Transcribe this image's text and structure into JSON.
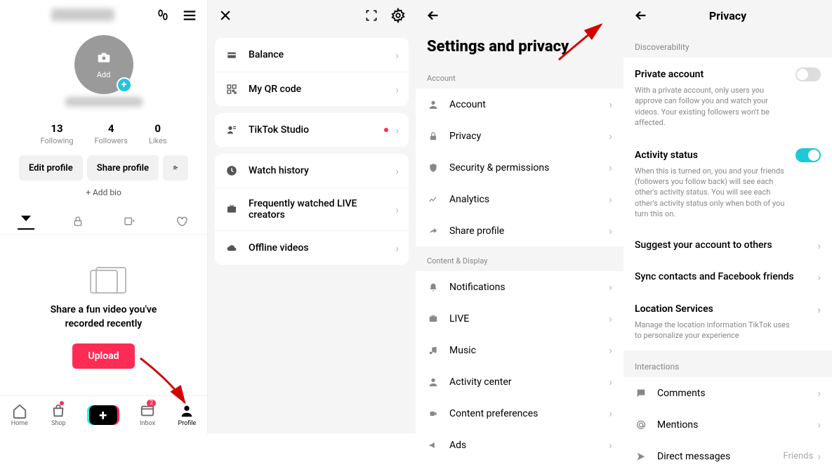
{
  "panel1": {
    "avatar_add": "Add",
    "stats": [
      {
        "num": "13",
        "lbl": "Following"
      },
      {
        "num": "4",
        "lbl": "Followers"
      },
      {
        "num": "0",
        "lbl": "Likes"
      }
    ],
    "edit_btn": "Edit profile",
    "share_btn": "Share profile",
    "add_bio": "+ Add bio",
    "empty_txt": "Share a fun video you've\nrecorded recently",
    "upload": "Upload",
    "nav": [
      {
        "lbl": "Home"
      },
      {
        "lbl": "Shop"
      },
      {
        "lbl": "Inbox",
        "badge": "2"
      },
      {
        "lbl": "Profile"
      }
    ]
  },
  "panel2": {
    "card1": [
      {
        "icon": "wallet",
        "label": "Balance"
      },
      {
        "icon": "qr",
        "label": "My QR code"
      }
    ],
    "card2": [
      {
        "icon": "studio",
        "label": "TikTok Studio",
        "dot": true
      }
    ],
    "card3": [
      {
        "icon": "clock",
        "label": "Watch history"
      },
      {
        "icon": "live",
        "label": "Frequently watched LIVE creators"
      },
      {
        "icon": "cloud",
        "label": "Offline videos"
      }
    ]
  },
  "panel3": {
    "title": "Settings and privacy",
    "sec_account": "Account",
    "account_items": [
      {
        "icon": "person",
        "label": "Account"
      },
      {
        "icon": "lock",
        "label": "Privacy"
      },
      {
        "icon": "shield",
        "label": "Security & permissions"
      },
      {
        "icon": "chart",
        "label": "Analytics"
      },
      {
        "icon": "share",
        "label": "Share profile"
      }
    ],
    "sec_content": "Content & Display",
    "content_items": [
      {
        "icon": "bell",
        "label": "Notifications"
      },
      {
        "icon": "tv",
        "label": "LIVE"
      },
      {
        "icon": "music",
        "label": "Music"
      },
      {
        "icon": "activity",
        "label": "Activity center"
      },
      {
        "icon": "video",
        "label": "Content preferences"
      },
      {
        "icon": "ads",
        "label": "Ads"
      }
    ]
  },
  "panel4": {
    "title": "Privacy",
    "sec_disc": "Discoverability",
    "private": {
      "title": "Private account",
      "desc": "With a private account, only users you approve can follow you and watch your videos. Your existing followers won't be affected.",
      "on": false
    },
    "activity": {
      "title": "Activity status",
      "desc": "When this is turned on, you and your friends (followers you follow back) will see each other's activity status. You will see each other's activity status only when both of you turn this on.",
      "on": true
    },
    "rows": [
      {
        "label": "Suggest your account to others"
      },
      {
        "label": "Sync contacts and Facebook friends"
      }
    ],
    "location": {
      "title": "Location Services",
      "desc": "Manage the location information TikTok uses to personalize your experience"
    },
    "sec_int": "Interactions",
    "interactions": [
      {
        "icon": "comment",
        "label": "Comments"
      },
      {
        "icon": "at",
        "label": "Mentions"
      },
      {
        "icon": "dm",
        "label": "Direct messages",
        "val": "Friends"
      }
    ]
  },
  "colors": {
    "accent": "#fe2c55",
    "teal": "#1ec8d8"
  }
}
